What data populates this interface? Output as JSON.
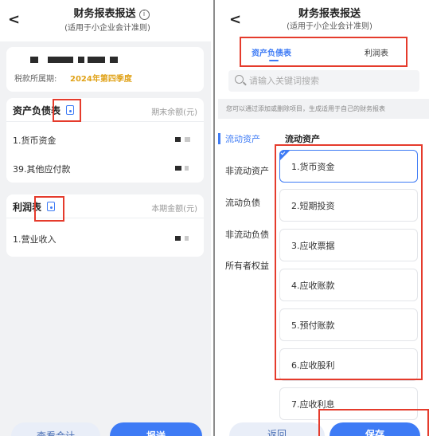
{
  "left_panel": {
    "title": "财务报表报送",
    "subtitle": "(适用于小企业会计准则)",
    "tax_period_label": "税款所属期:",
    "tax_period_value": "2024年第四季度",
    "balance_sheet": {
      "title": "资产负债表",
      "column_label": "期末余额(元)",
      "rows": [
        "1.货币资金",
        "39.其他应付款"
      ]
    },
    "income_statement": {
      "title": "利润表",
      "column_label": "本期金额(元)",
      "rows": [
        "1.营业收入"
      ]
    },
    "buttons": {
      "view_total": "查看合计",
      "submit": "报送"
    }
  },
  "right_panel": {
    "title": "财务报表报送",
    "subtitle": "(适用于小企业会计准则)",
    "tabs": [
      "资产负债表",
      "利润表"
    ],
    "active_tab": "资产负债表",
    "search_placeholder": "请输入关键词搜索",
    "hint": "您可以通过添加或删除项目，生成适用于自己的财务报表",
    "categories": [
      "流动资产",
      "非流动资产",
      "流动负债",
      "非流动负债",
      "所有者权益"
    ],
    "active_category": "流动资产",
    "section_title": "流动资产",
    "items": [
      "1.货币资金",
      "2.短期投资",
      "3.应收票据",
      "4.应收账款",
      "5.预付账款",
      "6.应收股利",
      "7.应收利息"
    ],
    "selected_item": "1.货币资金",
    "buttons": {
      "back": "返回",
      "save": "保存"
    }
  },
  "colors": {
    "accent": "#3e7bf5",
    "highlight_box": "#e53b2c",
    "period": "#e0a218"
  },
  "icons": [
    "chevron-left-icon",
    "info-icon",
    "document-icon",
    "search-icon",
    "check-icon"
  ]
}
